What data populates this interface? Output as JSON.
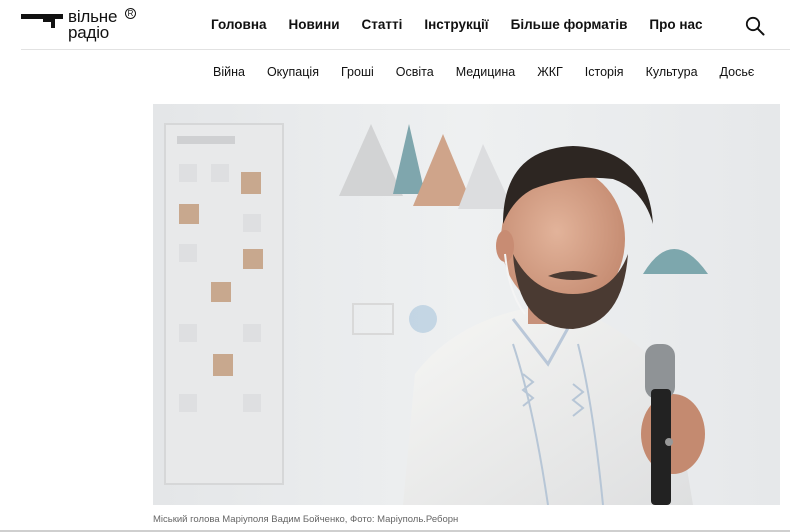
{
  "logo": {
    "line1": "вільне",
    "line2": "радіо",
    "reg": "R"
  },
  "main_nav": [
    {
      "label": "Головна"
    },
    {
      "label": "Новини"
    },
    {
      "label": "Статті"
    },
    {
      "label": "Інструкції"
    },
    {
      "label": "Більше форматів"
    },
    {
      "label": "Про нас"
    }
  ],
  "categories": [
    {
      "label": "Війна"
    },
    {
      "label": "Окупація"
    },
    {
      "label": "Гроші"
    },
    {
      "label": "Освіта"
    },
    {
      "label": "Медицина"
    },
    {
      "label": "ЖКГ"
    },
    {
      "label": "Історія"
    },
    {
      "label": "Культура"
    },
    {
      "label": "Досьє"
    }
  ],
  "icons": {
    "search": "search-icon",
    "logo_mark": "logo-mark-icon"
  },
  "article": {
    "photo_caption": "Міський голова Маріуполя Вадим Бойченко, Фото: Маріуполь.Реборн"
  },
  "colors": {
    "text": "#111111",
    "divider": "#e2e2e2",
    "caption": "#666666"
  }
}
